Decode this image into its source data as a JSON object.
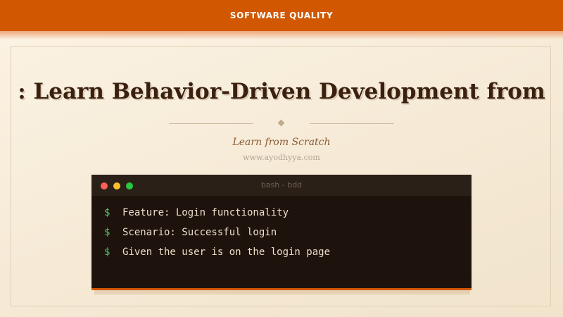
{
  "header": {
    "category": "SOFTWARE QUALITY"
  },
  "hero": {
    "title": ": Learn Behavior-Driven Development from",
    "subtitle": "Learn from Scratch",
    "site": "www.ayodhyya.com"
  },
  "terminal": {
    "title": "bash - bdd",
    "prompt_symbol": "$",
    "lines": [
      "Feature: Login functionality",
      "Scenario: Successful login",
      "Given the user is on the login page"
    ]
  },
  "colors": {
    "accent": "#d15800",
    "background": "#f6ead6",
    "heading": "#3b2010",
    "terminal_bg": "#1e130c",
    "prompt": "#4fc26a"
  },
  "icons": {
    "window_controls": [
      "close-dot",
      "minimize-dot",
      "maximize-dot"
    ],
    "divider_ornament": "diamond-ornament"
  }
}
